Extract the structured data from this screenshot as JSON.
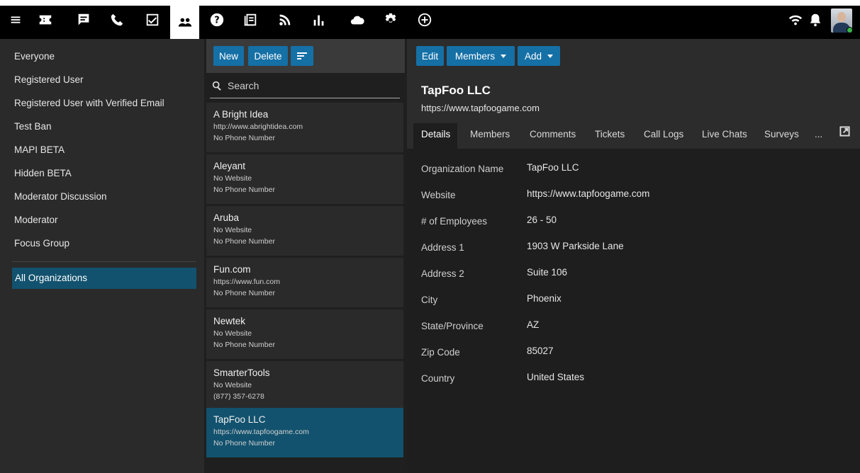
{
  "topbar": {
    "icons": [
      "menu-icon",
      "tickets-icon",
      "chat-icon",
      "phone-icon",
      "tasks-icon",
      "people-icon",
      "help-icon",
      "knowledge-base-icon",
      "rss-icon",
      "reports-icon",
      "cloud-icon",
      "settings-icon",
      "add-icon",
      "wifi-icon",
      "bell-icon"
    ],
    "active_icon": "people-icon"
  },
  "sidebar": {
    "items": [
      {
        "label": "Everyone"
      },
      {
        "label": "Registered User"
      },
      {
        "label": "Registered User with Verified Email"
      },
      {
        "label": "Test Ban"
      },
      {
        "label": "MAPI BETA"
      },
      {
        "label": "Hidden BETA"
      },
      {
        "label": "Moderator Discussion"
      },
      {
        "label": "Moderator"
      },
      {
        "label": "Focus Group"
      }
    ],
    "selected_label": "All Organizations"
  },
  "list": {
    "new_label": "New",
    "delete_label": "Delete",
    "search_placeholder": "Search",
    "orgs": [
      {
        "name": "A Bright Idea",
        "website": "http://www.abrightidea.com",
        "phone": "No Phone Number"
      },
      {
        "name": "Aleyant",
        "website": "No Website",
        "phone": "No Phone Number"
      },
      {
        "name": "Aruba",
        "website": "No Website",
        "phone": "No Phone Number"
      },
      {
        "name": "Fun.com",
        "website": "https://www.fun.com",
        "phone": "No Phone Number"
      },
      {
        "name": "Newtek",
        "website": "No Website",
        "phone": "No Phone Number"
      },
      {
        "name": "SmarterTools",
        "website": "No Website",
        "phone": "(877) 357-6278"
      },
      {
        "name": "TapFoo LLC",
        "website": "https://www.tapfoogame.com",
        "phone": "No Phone Number"
      }
    ]
  },
  "detail": {
    "edit_label": "Edit",
    "members_label": "Members",
    "add_label": "Add",
    "title": "TapFoo LLC",
    "subtitle": "https://www.tapfoogame.com",
    "tabs": [
      "Details",
      "Members",
      "Comments",
      "Tickets",
      "Call Logs",
      "Live Chats",
      "Surveys",
      "..."
    ],
    "fields": [
      {
        "label": "Organization Name",
        "value": "TapFoo LLC"
      },
      {
        "label": "Website",
        "value": "https://www.tapfoogame.com"
      },
      {
        "label": "# of Employees",
        "value": "26 - 50"
      },
      {
        "label": "Address 1",
        "value": "1903 W Parkside Lane"
      },
      {
        "label": "Address 2",
        "value": "Suite 106"
      },
      {
        "label": "City",
        "value": "Phoenix"
      },
      {
        "label": "State/Province",
        "value": "AZ"
      },
      {
        "label": "Zip Code",
        "value": "85027"
      },
      {
        "label": "Country",
        "value": "United States"
      }
    ]
  },
  "colors": {
    "accent": "#1570a6",
    "selected": "#12526e",
    "online": "#39b54a"
  }
}
